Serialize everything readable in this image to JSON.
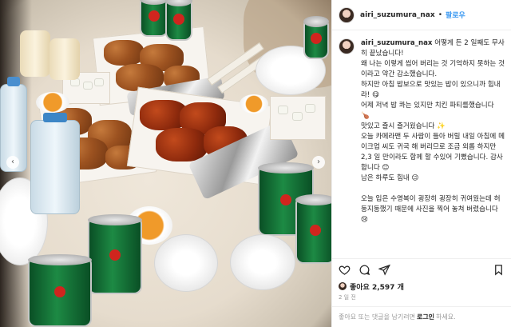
{
  "post": {
    "username": "airi_suzumura_nax",
    "follow_label": "팔로우",
    "separator": "•",
    "caption_username": "airi_suzumura_nax",
    "caption_text": "어떻게 든 2 일째도 무사히 끝났습니다!\n왜 나는 이렇게 씹어 버리는 것 기억하지 못하는 것이라고 약간 감소했습니다.\n하지만 아침 밥보으로 맛있는 밥이 있으니까 힘내라! 😋\n어제 저녁 밥 콰는 있지만 치킨 파티를했습니다 🍗\n맛있고 즐시 즐거웠습니다 ✨\n오늘 카메라맨 두 사람이 들아 버릴 내일 아침에 메이크업 씨도 귀국 해 버리므로 조금 외롭 하지만 2,3 일 만이라도 함께 할 수있어 기뻤습니다. 감사합니다 😊\n남은 하루도 힘내 😉\n\n오늘 입은 수영복이 굉장히 굉장히 귀여웠는데 허둥지둥했기 때문에 사진을 찍어 놓쳐 버렸습니다 😢",
    "likes_text": "좋아요 2,597 개",
    "time_ago": "2 일 전",
    "comment_prompt": "좋아요 또는 댓글을 남기려면",
    "login_label": "로그인",
    "comment_suffix": "하세요."
  },
  "icons": {
    "like": "heart-icon",
    "comment": "comment-icon",
    "share": "share-icon",
    "save": "bookmark-icon",
    "prev": "chevron-left-icon",
    "next": "chevron-right-icon"
  },
  "colors": {
    "link_blue": "#3897f0",
    "text": "#262626",
    "muted": "#999999",
    "border": "#efefef"
  }
}
